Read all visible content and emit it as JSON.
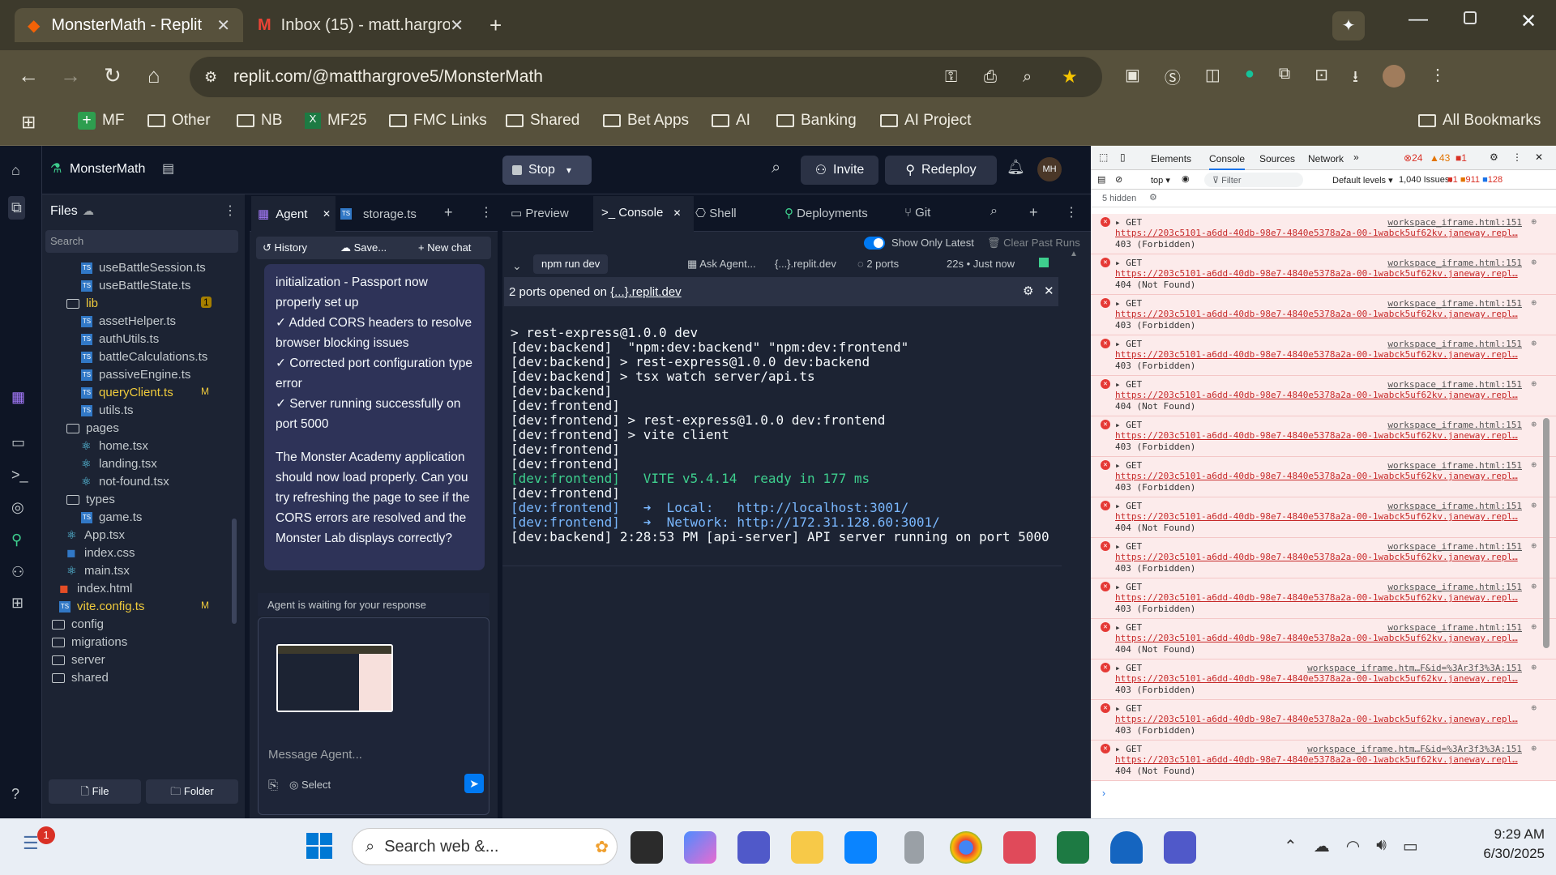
{
  "browser": {
    "tabs": [
      {
        "label": "MonsterMath - Replit"
      },
      {
        "label": "Inbox (15) - matt.hargrove5@g"
      }
    ],
    "url": "replit.com/@matthargrove5/MonsterMath",
    "bookmarks": [
      "MF",
      "Other",
      "NB",
      "MF25",
      "FMC Links",
      "Shared",
      "Bet Apps",
      "AI",
      "Banking",
      "AI Project"
    ],
    "all_bookmarks": "All Bookmarks"
  },
  "replit": {
    "project": "MonsterMath",
    "stop": "Stop",
    "invite": "Invite",
    "redeploy": "Redeploy",
    "avatar": "MH",
    "files_title": "Files",
    "search_placeholder": "Search",
    "tree": [
      {
        "name": "useBattleSession.ts",
        "kind": "ts"
      },
      {
        "name": "useBattleState.ts",
        "kind": "ts"
      },
      {
        "name": "lib",
        "kind": "folder",
        "badge": "1"
      },
      {
        "name": "assetHelper.ts",
        "kind": "ts"
      },
      {
        "name": "authUtils.ts",
        "kind": "ts"
      },
      {
        "name": "battleCalculations.ts",
        "kind": "ts"
      },
      {
        "name": "passiveEngine.ts",
        "kind": "ts"
      },
      {
        "name": "queryClient.ts",
        "kind": "ts",
        "badge": "M"
      },
      {
        "name": "utils.ts",
        "kind": "ts"
      },
      {
        "name": "pages",
        "kind": "folder"
      },
      {
        "name": "home.tsx",
        "kind": "tsx"
      },
      {
        "name": "landing.tsx",
        "kind": "tsx"
      },
      {
        "name": "not-found.tsx",
        "kind": "tsx"
      },
      {
        "name": "types",
        "kind": "folder"
      },
      {
        "name": "game.ts",
        "kind": "ts"
      },
      {
        "name": "App.tsx",
        "kind": "tsx"
      },
      {
        "name": "index.css",
        "kind": "css"
      },
      {
        "name": "main.tsx",
        "kind": "tsx"
      },
      {
        "name": "index.html",
        "kind": "html"
      },
      {
        "name": "vite.config.ts",
        "kind": "ts",
        "badge": "M"
      },
      {
        "name": "config",
        "kind": "folder"
      },
      {
        "name": "migrations",
        "kind": "folder"
      },
      {
        "name": "server",
        "kind": "folder"
      },
      {
        "name": "shared",
        "kind": "folder"
      }
    ],
    "file_btn": "File",
    "folder_btn": "Folder",
    "tabs": {
      "agent": "Agent",
      "storage": "storage.ts",
      "preview": "Preview",
      "console": "Console",
      "shell": "Shell",
      "deployments": "Deployments",
      "git": "Git"
    },
    "agent": {
      "history": "History",
      "save": "Save...",
      "new_chat": "New chat",
      "messages": [
        "initialization - Passport now properly set up",
        "✓ Added CORS headers to resolve browser blocking issues",
        "✓ Corrected port configuration type error",
        "✓ Server running successfully on port 5000",
        "The Monster Academy application should now load properly. Can you try refreshing the page to see if the CORS errors are resolved and the Monster Lab displays correctly?"
      ],
      "waiting": "Agent is waiting for your response",
      "input_placeholder": "Message Agent...",
      "select": "Select"
    },
    "console": {
      "show_latest": "Show Only Latest",
      "clear": "Clear Past Runs",
      "run": "npm run dev",
      "ask": "Ask Agent...",
      "domain": "{...}.replit.dev",
      "ports": "2 ports",
      "time": "22s • Just now",
      "ports_opened": "2 ports opened on",
      "ports_link": "{...}.replit.dev",
      "lines": [
        "> rest-express@1.0.0 dev",
        "[dev:backend]  \"npm:dev:backend\" \"npm:dev:frontend\"",
        "[dev:backend] > rest-express@1.0.0 dev:backend",
        "[dev:backend] > tsx watch server/api.ts",
        "[dev:backend]",
        "[dev:frontend]",
        "[dev:frontend] > rest-express@1.0.0 dev:frontend",
        "[dev:frontend] > vite client",
        "[dev:frontend]",
        "[dev:frontend]",
        "[dev:frontend]   VITE v5.4.14  ready in 177 ms",
        "[dev:frontend]",
        "[dev:frontend]   ➜  Local:   http://localhost:3001/",
        "[dev:frontend]   ➜  Network: http://172.31.128.60:3001/",
        "[dev:backend] 2:28:53 PM [api-server] API server running on port 5000"
      ]
    }
  },
  "devtools": {
    "tabs": [
      "Elements",
      "Console",
      "Sources",
      "Network"
    ],
    "errors": "24",
    "warnings": "43",
    "info": "1",
    "context": "top",
    "filter": "Filter",
    "levels": "Default levels",
    "issues": "1,040 Issues:",
    "issue_counts": [
      "1",
      "911",
      "128"
    ],
    "hidden": "5 hidden",
    "logs": [
      {
        "src": "workspace_iframe.html:151",
        "status": "403 (Forbidden)"
      },
      {
        "src": "workspace_iframe.html:151",
        "status": "404 (Not Found)"
      },
      {
        "src": "workspace_iframe.html:151",
        "status": "403 (Forbidden)"
      },
      {
        "src": "workspace_iframe.html:151",
        "status": "403 (Forbidden)"
      },
      {
        "src": "workspace_iframe.html:151",
        "status": "404 (Not Found)"
      },
      {
        "src": "workspace_iframe.html:151",
        "status": "403 (Forbidden)"
      },
      {
        "src": "workspace_iframe.html:151",
        "status": "403 (Forbidden)"
      },
      {
        "src": "workspace_iframe.html:151",
        "status": "404 (Not Found)"
      },
      {
        "src": "workspace_iframe.html:151",
        "status": "403 (Forbidden)"
      },
      {
        "src": "workspace_iframe.html:151",
        "status": "403 (Forbidden)"
      },
      {
        "src": "workspace_iframe.html:151",
        "status": "404 (Not Found)"
      },
      {
        "src": "workspace_iframe.htm…F&id=%3Ar3f3%3A:151",
        "status": "403 (Forbidden)"
      },
      {
        "src": "",
        "status": "403 (Forbidden)"
      },
      {
        "src": "workspace_iframe.htm…F&id=%3Ar3f3%3A:151",
        "status": "404 (Not Found)"
      }
    ],
    "get": "▸ GET",
    "url": "https://203c5101-a6dd-40db-98e7-4840e5378a2a-00-1wabck5uf62kv.janeway.repl…"
  },
  "taskbar": {
    "search": "Search web &...",
    "time": "9:29 AM",
    "date": "6/30/2025",
    "notif": "1"
  }
}
